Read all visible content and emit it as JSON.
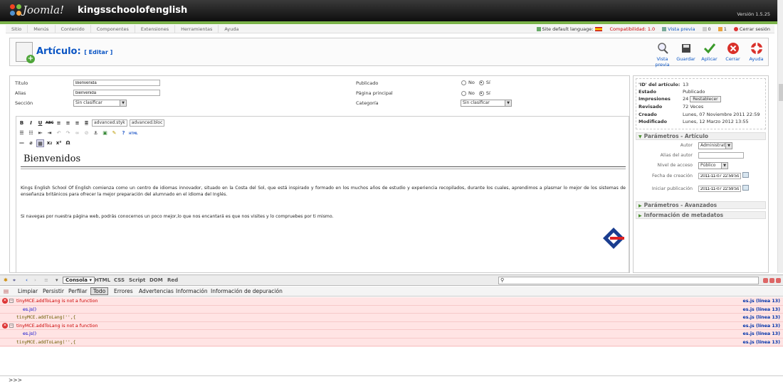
{
  "header": {
    "logo_text": "Joomla!",
    "site_name": "kingsschoolofenglish",
    "version": "Versión 1.5.25"
  },
  "menu": {
    "items": [
      "Sitio",
      "Menús",
      "Contenido",
      "Componentes",
      "Extensiones",
      "Herramientas",
      "Ayuda"
    ]
  },
  "status": {
    "language": "Site default language:",
    "compat": "Compatibilidad: 1.0",
    "preview": "Vista previa",
    "messages": "0",
    "users": "1",
    "logout": "Cerrar sesión"
  },
  "toolbar": {
    "title": "Artículo:",
    "subtitle": "[ Editar ]",
    "buttons": [
      "Vista previa",
      "Guardar",
      "Aplicar",
      "Cerrar",
      "Ayuda"
    ]
  },
  "form": {
    "title_label": "Título",
    "title_value": "Bienvenida",
    "alias_label": "Alias",
    "alias_value": "bienvenida",
    "section_label": "Sección",
    "section_value": "Sin clasificar",
    "published_label": "Publicado",
    "frontpage_label": "Página principal",
    "category_label": "Categoría",
    "category_value": "Sin clasificar",
    "no": "No",
    "yes": "Sí"
  },
  "editor": {
    "style_select": "advanced.styk",
    "block_select": "advanced.bloc",
    "heading": "Bienvenidos",
    "paragraph1": "Kings English School Of English comienza como un centro de idiomas innovador, situado en la Costa del Sol, que está inspirado y formado en los muchos años de estudio y experiencia recopilados, durante los cuales, aprendimos a plasmar lo mejor de los sistemas de enseñanza británicos para ofrecer la mejor preparación del alumnado en el idioma del Inglés.",
    "paragraph2": "Si navegas por nuestra página web, podrás conocernos un poco mejor,lo que nos encantará es que nos visites y lo compruebes por ti mismo."
  },
  "info": {
    "id_label": "'ID' del artículo:",
    "id_value": "13",
    "state_label": "Estado",
    "state_value": "Publicado",
    "impressions_label": "Impresiones",
    "impressions_value": "24",
    "reset_label": "Restablecer",
    "revised_label": "Revisado",
    "revised_value": "72 Veces",
    "created_label": "Creado",
    "created_value": "Lunes, 07 Noviembre 2011 22:59",
    "modified_label": "Modificado",
    "modified_value": "Lunes, 12 Marzo 2012 13:55"
  },
  "params": {
    "heading": "Parámetros - Artículo",
    "author_label": "Autor",
    "author_value": "Administrator",
    "alias_label": "Alias del autor",
    "access_label": "Nivel de acceso",
    "access_value": "Público",
    "created_label": "Fecha de creación",
    "created_value": "2011-11-07 22:59:59",
    "start_label": "Iniciar publicación",
    "start_value": "2011-11-07 22:59:59",
    "advanced_heading": "Parámetros - Avanzados",
    "meta_heading": "Información de metadatos"
  },
  "firebug": {
    "tabs": [
      "Consola",
      "HTML",
      "CSS",
      "Script",
      "DOM",
      "Red"
    ],
    "filters": [
      "Limpiar",
      "Persistir",
      "Perfilar",
      "Todo",
      "Errores",
      "Advertencias",
      "Información",
      "Información de depuración"
    ],
    "rows": [
      {
        "type": "error",
        "text": "tinyMCE.addToLang is not a function",
        "file": "es.js (línea 13)"
      },
      {
        "type": "call",
        "text": "es.js()",
        "file": "es.js (línea 13)"
      },
      {
        "type": "src",
        "text": "tinyMCE.addToLang('',{",
        "file": "es.js (línea 13)"
      },
      {
        "type": "error",
        "text": "tinyMCE.addToLang is not a function",
        "file": "es.js (línea 13)"
      },
      {
        "type": "call",
        "text": "es.js()",
        "file": "es.js (línea 13)"
      },
      {
        "type": "src",
        "text": "tinyMCE.addToLang('',{",
        "file": "es.js (línea 13)"
      }
    ],
    "prompt": ">>>"
  },
  "colors": {
    "header_green": "#7bb34a",
    "link_blue": "#0b55c4",
    "error_bg": "#ffe4e4"
  }
}
